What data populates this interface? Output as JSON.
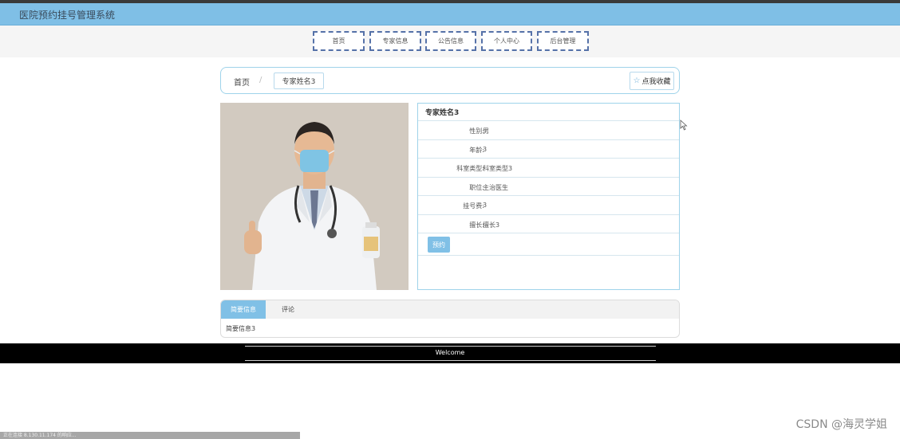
{
  "site": {
    "title": "医院预约挂号管理系统"
  },
  "nav": [
    {
      "label": "首页"
    },
    {
      "label": "专家信息"
    },
    {
      "label": "公告信息"
    },
    {
      "label": "个人中心"
    },
    {
      "label": "后台管理"
    }
  ],
  "breadcrumb": {
    "home": "首页",
    "separator": "/",
    "current": "专家姓名3"
  },
  "favorite": {
    "label": "点我收藏",
    "icon": "star-outline-icon"
  },
  "photo": {
    "description_icon": "doctor-photo"
  },
  "expert": {
    "name": "专家姓名3",
    "fields": [
      {
        "label": "性别:",
        "value": "男"
      },
      {
        "label": "年龄:",
        "value": "3"
      },
      {
        "label": "科室类型:",
        "value": "科室类型3"
      },
      {
        "label": "职位:",
        "value": "主治医生"
      },
      {
        "label": "挂号费:",
        "value": "3"
      },
      {
        "label": "擅长:",
        "value": "擅长3"
      }
    ],
    "book_label": "预约"
  },
  "tabs": {
    "intro_label": "简要信息",
    "comment_label": "评论",
    "content": "简要信息3"
  },
  "footer": {
    "text": "Welcome"
  },
  "status": {
    "text": "正在连接 8.130.11.174 的响应..."
  },
  "watermark": "CSDN @海灵学姐",
  "colors": {
    "header": "#7fbfe6",
    "accent": "#80c0e6",
    "nav_border": "#5571a8",
    "footer": "#000000"
  }
}
